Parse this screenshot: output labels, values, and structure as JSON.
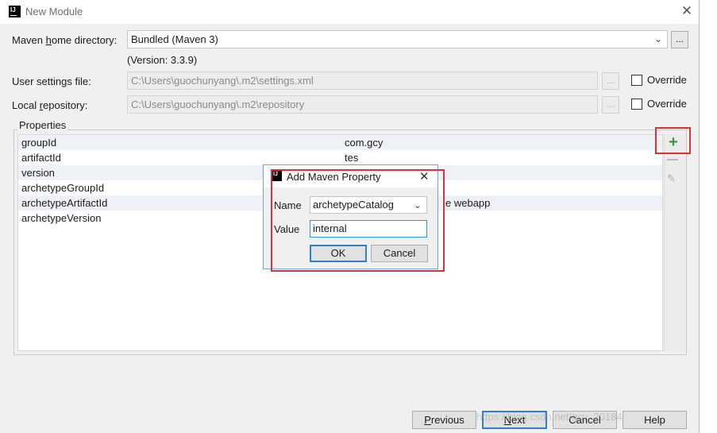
{
  "window": {
    "title": "New Module",
    "icon": "intellij-logo-icon",
    "close_icon": "close-icon"
  },
  "form": {
    "maven_home_label_pre": "Maven ",
    "maven_home_label_u": "h",
    "maven_home_label_post": "ome directory:",
    "maven_home_value": "Bundled (Maven 3)",
    "version_note": "(Version: 3.3.9)",
    "user_settings_label": "User settings file:",
    "user_settings_value": "C:\\Users\\guochunyang\\.m2\\settings.xml",
    "local_repo_label_pre": "Local ",
    "local_repo_label_u": "r",
    "local_repo_label_post": "epository:",
    "local_repo_value": "C:\\Users\\guochunyang\\.m2\\repository",
    "override_label": "Override",
    "browse_label": "...",
    "user_settings_override": false,
    "local_repo_override": false
  },
  "properties": {
    "legend": "Properties",
    "rows": [
      {
        "key": "groupId",
        "value": "com.gcy"
      },
      {
        "key": "artifactId",
        "value": "tes"
      },
      {
        "key": "version",
        "value": ""
      },
      {
        "key": "archetypeGroupId",
        "value": ""
      },
      {
        "key": "archetypeArtifactId",
        "value": "e webapp"
      },
      {
        "key": "archetypeVersion",
        "value": ""
      }
    ],
    "add_icon": "plus-icon",
    "remove_icon": "minus-icon",
    "edit_icon": "pencil-icon",
    "highlight_color": "#d9303b"
  },
  "dialog": {
    "title": "Add Maven Property",
    "name_label": "Name",
    "name_value": "archetypeCatalog",
    "value_label": "Value",
    "value_value": "internal",
    "ok_label": "OK",
    "cancel_label": "Cancel"
  },
  "footer": {
    "previous_u": "P",
    "previous_rest": "revious",
    "next_u": "N",
    "next_rest": "ext",
    "cancel_label": "Cancel",
    "help_label": "Help",
    "watermark": "https://blog.csdn.net/gcy_20184"
  }
}
